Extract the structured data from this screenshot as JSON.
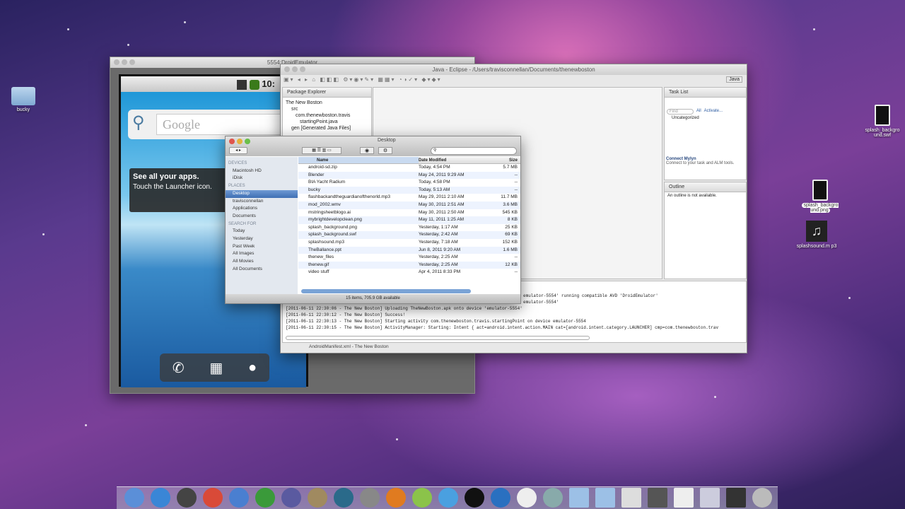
{
  "desktop": {
    "left_icons": [
      {
        "label": "bucky"
      }
    ],
    "right_icons": [
      {
        "label": "splash_backgro und.swf"
      },
      {
        "label": "splash_backgro und.png"
      },
      {
        "label": "splashsound.m p3"
      }
    ]
  },
  "emulator": {
    "title": "5554:DroidEmulator",
    "clock": "10:",
    "search_placeholder": "Google",
    "tip_title": "See all your apps.",
    "tip_body": "Touch the Launcher icon."
  },
  "eclipse": {
    "title": "Java - Eclipse - /Users/travisconnellan/Documents/thenewboston",
    "perspective": "Java",
    "package_explorer": {
      "tab": "Package Explorer",
      "tree": [
        "The New Boston",
        "src",
        "com.thenewboston.travis",
        "startingPoint.java",
        "gen [Generated Java Files]"
      ]
    },
    "task_list": {
      "tab": "Task List",
      "find_placeholder": "Find",
      "all": "All",
      "activate": "Activate...",
      "category": "Uncategorized"
    },
    "mylyn": {
      "title": "Connect Mylyn",
      "body": "Connect to your task and ALM tools."
    },
    "outline": {
      "tab": "Outline",
      "message": "An outline is not available."
    },
    "console": [
      "emulator-5554' running compatible AVD 'DroidEmulator'",
      "emulator-5554'",
      "[2011-06-11 22:30:06 - The New Boston] Uploading TheNewBoston.apk onto device 'emulator-5554'",
      "[2011-06-11 22:30:12 - The New Boston] Success!",
      "[2011-06-11 22:30:13 - The New Boston] Starting activity com.thenewboston.travis.startingPoint on device emulator-5554",
      "[2011-06-11 22:30:15 - The New Boston] ActivityManager: Starting: Intent { act=android.intent.action.MAIN cat=[android.intent.category.LAUNCHER] cmp=com.thenewboston.trav"
    ],
    "status": "AndroidManifest.xml - The New Boston"
  },
  "finder": {
    "title": "Desktop",
    "search_placeholder": "",
    "columns": {
      "name": "Name",
      "date": "Date Modified",
      "size": "Size"
    },
    "sidebar": [
      {
        "label": "DEVICES",
        "header": true
      },
      {
        "label": "Macintosh HD"
      },
      {
        "label": "iDisk"
      },
      {
        "label": "PLACES",
        "header": true
      },
      {
        "label": "Desktop",
        "selected": true
      },
      {
        "label": "travisconnellan"
      },
      {
        "label": "Applications"
      },
      {
        "label": "Documents"
      },
      {
        "label": "SEARCH FOR",
        "header": true
      },
      {
        "label": "Today"
      },
      {
        "label": "Yesterday"
      },
      {
        "label": "Past Week"
      },
      {
        "label": "All Images"
      },
      {
        "label": "All Movies"
      },
      {
        "label": "All Documents"
      }
    ],
    "files": [
      {
        "name": "android-sd.zip",
        "date": "Today, 4:54 PM",
        "size": "5.7 MB"
      },
      {
        "name": "Blender",
        "date": "May 24, 2011 9:29 AM",
        "size": "--"
      },
      {
        "name": "BIA Yacht Radium",
        "date": "Today, 4:58 PM",
        "size": "--"
      },
      {
        "name": "bucky",
        "date": "Today, 5:13 AM",
        "size": "--"
      },
      {
        "name": "flashbackandtheguardianofthenorld.mp3",
        "date": "May 29, 2011 2:10 AM",
        "size": "11.7 MB"
      },
      {
        "name": "mod_2002.wmv",
        "date": "May 30, 2011 2:51 AM",
        "size": "3.6 MB"
      },
      {
        "name": "mstringsheetblogo.ai",
        "date": "May 30, 2011 2:50 AM",
        "size": "545 KB"
      },
      {
        "name": "mybrightdevelopclean.png",
        "date": "May 11, 2011 1:25 AM",
        "size": "8 KB"
      },
      {
        "name": "splash_background.png",
        "date": "Yesterday, 1:17 AM",
        "size": "25 KB"
      },
      {
        "name": "splash_background.swf",
        "date": "Yesterday, 2:42 AM",
        "size": "69 KB"
      },
      {
        "name": "splashsound.mp3",
        "date": "Yesterday, 7:18 AM",
        "size": "152 KB"
      },
      {
        "name": "TheBallance.ppt",
        "date": "Jun 8, 2011 9:20 AM",
        "size": "1.6 MB"
      },
      {
        "name": "thenew_files",
        "date": "Yesterday, 2:25 AM",
        "size": "--"
      },
      {
        "name": "thenew.gif",
        "date": "Yesterday, 2:25 AM",
        "size": "12 KB"
      },
      {
        "name": "video stuff",
        "date": "Apr 4, 2011 8:33 PM",
        "size": "--"
      }
    ],
    "status": "15 items, 705.9 GB available"
  },
  "dock": {
    "apps": [
      {
        "name": "finder",
        "color": "#5b8fd8"
      },
      {
        "name": "app-store",
        "color": "#3a86d6"
      },
      {
        "name": "facetime",
        "color": "#444"
      },
      {
        "name": "chrome",
        "color": "#d94a38"
      },
      {
        "name": "itunes",
        "color": "#4a7fd0"
      },
      {
        "name": "numbers",
        "color": "#3a9a3a"
      },
      {
        "name": "eclipse",
        "color": "#5a5aa0"
      },
      {
        "name": "gimp",
        "color": "#a08a60"
      },
      {
        "name": "time-machine",
        "color": "#2a6a8a"
      },
      {
        "name": "system-preferences",
        "color": "#888"
      },
      {
        "name": "blender",
        "color": "#e07b20"
      },
      {
        "name": "android",
        "color": "#8bc34a"
      },
      {
        "name": "safari",
        "color": "#4aa0e0"
      },
      {
        "name": "terminal",
        "color": "#111"
      },
      {
        "name": "quicktime",
        "color": "#2a70c0"
      },
      {
        "name": "x11",
        "color": "#eee"
      },
      {
        "name": "preview",
        "color": "#8aa"
      },
      {
        "name": "applications-folder",
        "color": "#9cc0e6"
      },
      {
        "name": "documents-folder",
        "color": "#9cc0e6"
      },
      {
        "name": "doc-1",
        "color": "#ddd"
      },
      {
        "name": "doc-2",
        "color": "#555"
      },
      {
        "name": "doc-3",
        "color": "#eee"
      },
      {
        "name": "doc-4",
        "color": "#ccd"
      },
      {
        "name": "doc-5",
        "color": "#333"
      },
      {
        "name": "trash",
        "color": "#bbb"
      }
    ]
  }
}
